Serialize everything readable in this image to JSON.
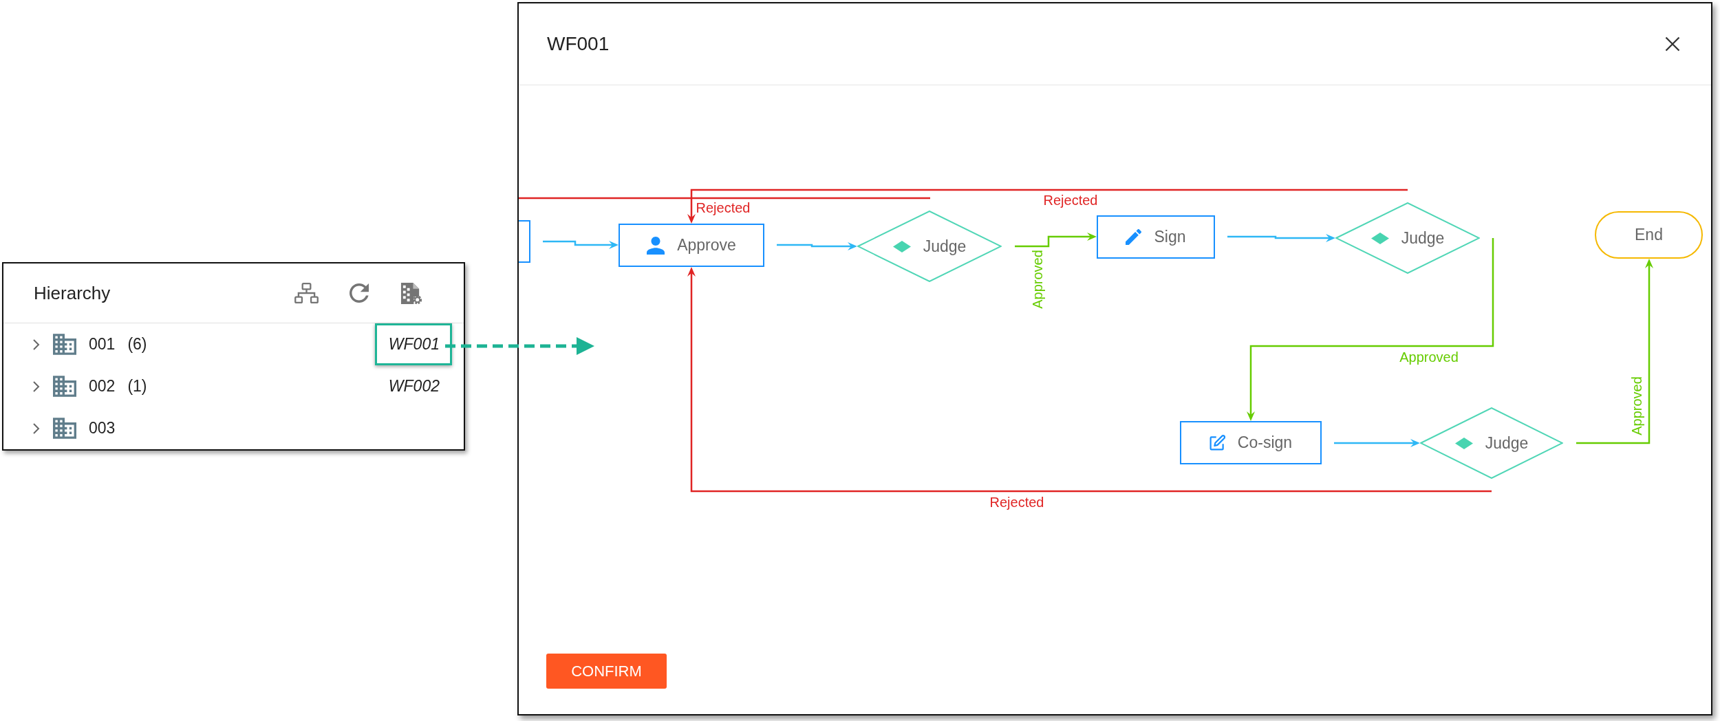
{
  "panel": {
    "title": "Hierarchy",
    "rows": [
      {
        "code": "001",
        "count": "(6)",
        "workflow": "WF001",
        "expanded": false,
        "highlighted": true
      },
      {
        "code": "002",
        "count": "(1)",
        "workflow": "WF002",
        "expanded": false,
        "highlighted": false
      },
      {
        "code": "003",
        "expanded": false,
        "highlighted": false
      }
    ]
  },
  "dialog": {
    "title": "WF001",
    "flow": {
      "nodes": [
        {
          "kind": "task"
        },
        {
          "kind": "approver",
          "label": "Approve"
        },
        {
          "kind": "decision",
          "label": "Judge"
        },
        {
          "kind": "signer",
          "label": "Sign"
        },
        {
          "kind": "decision",
          "label": "Judge"
        },
        {
          "kind": "cosigner",
          "label": "Co-sign"
        },
        {
          "kind": "decision",
          "label": "Judge"
        },
        {
          "kind": "end",
          "label": "End"
        }
      ],
      "edges": [
        {
          "kind": "flow"
        },
        {
          "kind": "flow"
        },
        {
          "kind": "approved",
          "label": "Approved"
        },
        {
          "kind": "flow"
        },
        {
          "kind": "approved",
          "label": "Approved"
        },
        {
          "kind": "flow"
        },
        {
          "kind": "approved",
          "label": "Approved"
        },
        {
          "kind": "rejected",
          "label": "Rejected"
        },
        {
          "kind": "rejected",
          "label": "Rejected"
        },
        {
          "kind": "rejected",
          "label": "Rejected"
        }
      ]
    },
    "confirm": "CONFIRM"
  }
}
